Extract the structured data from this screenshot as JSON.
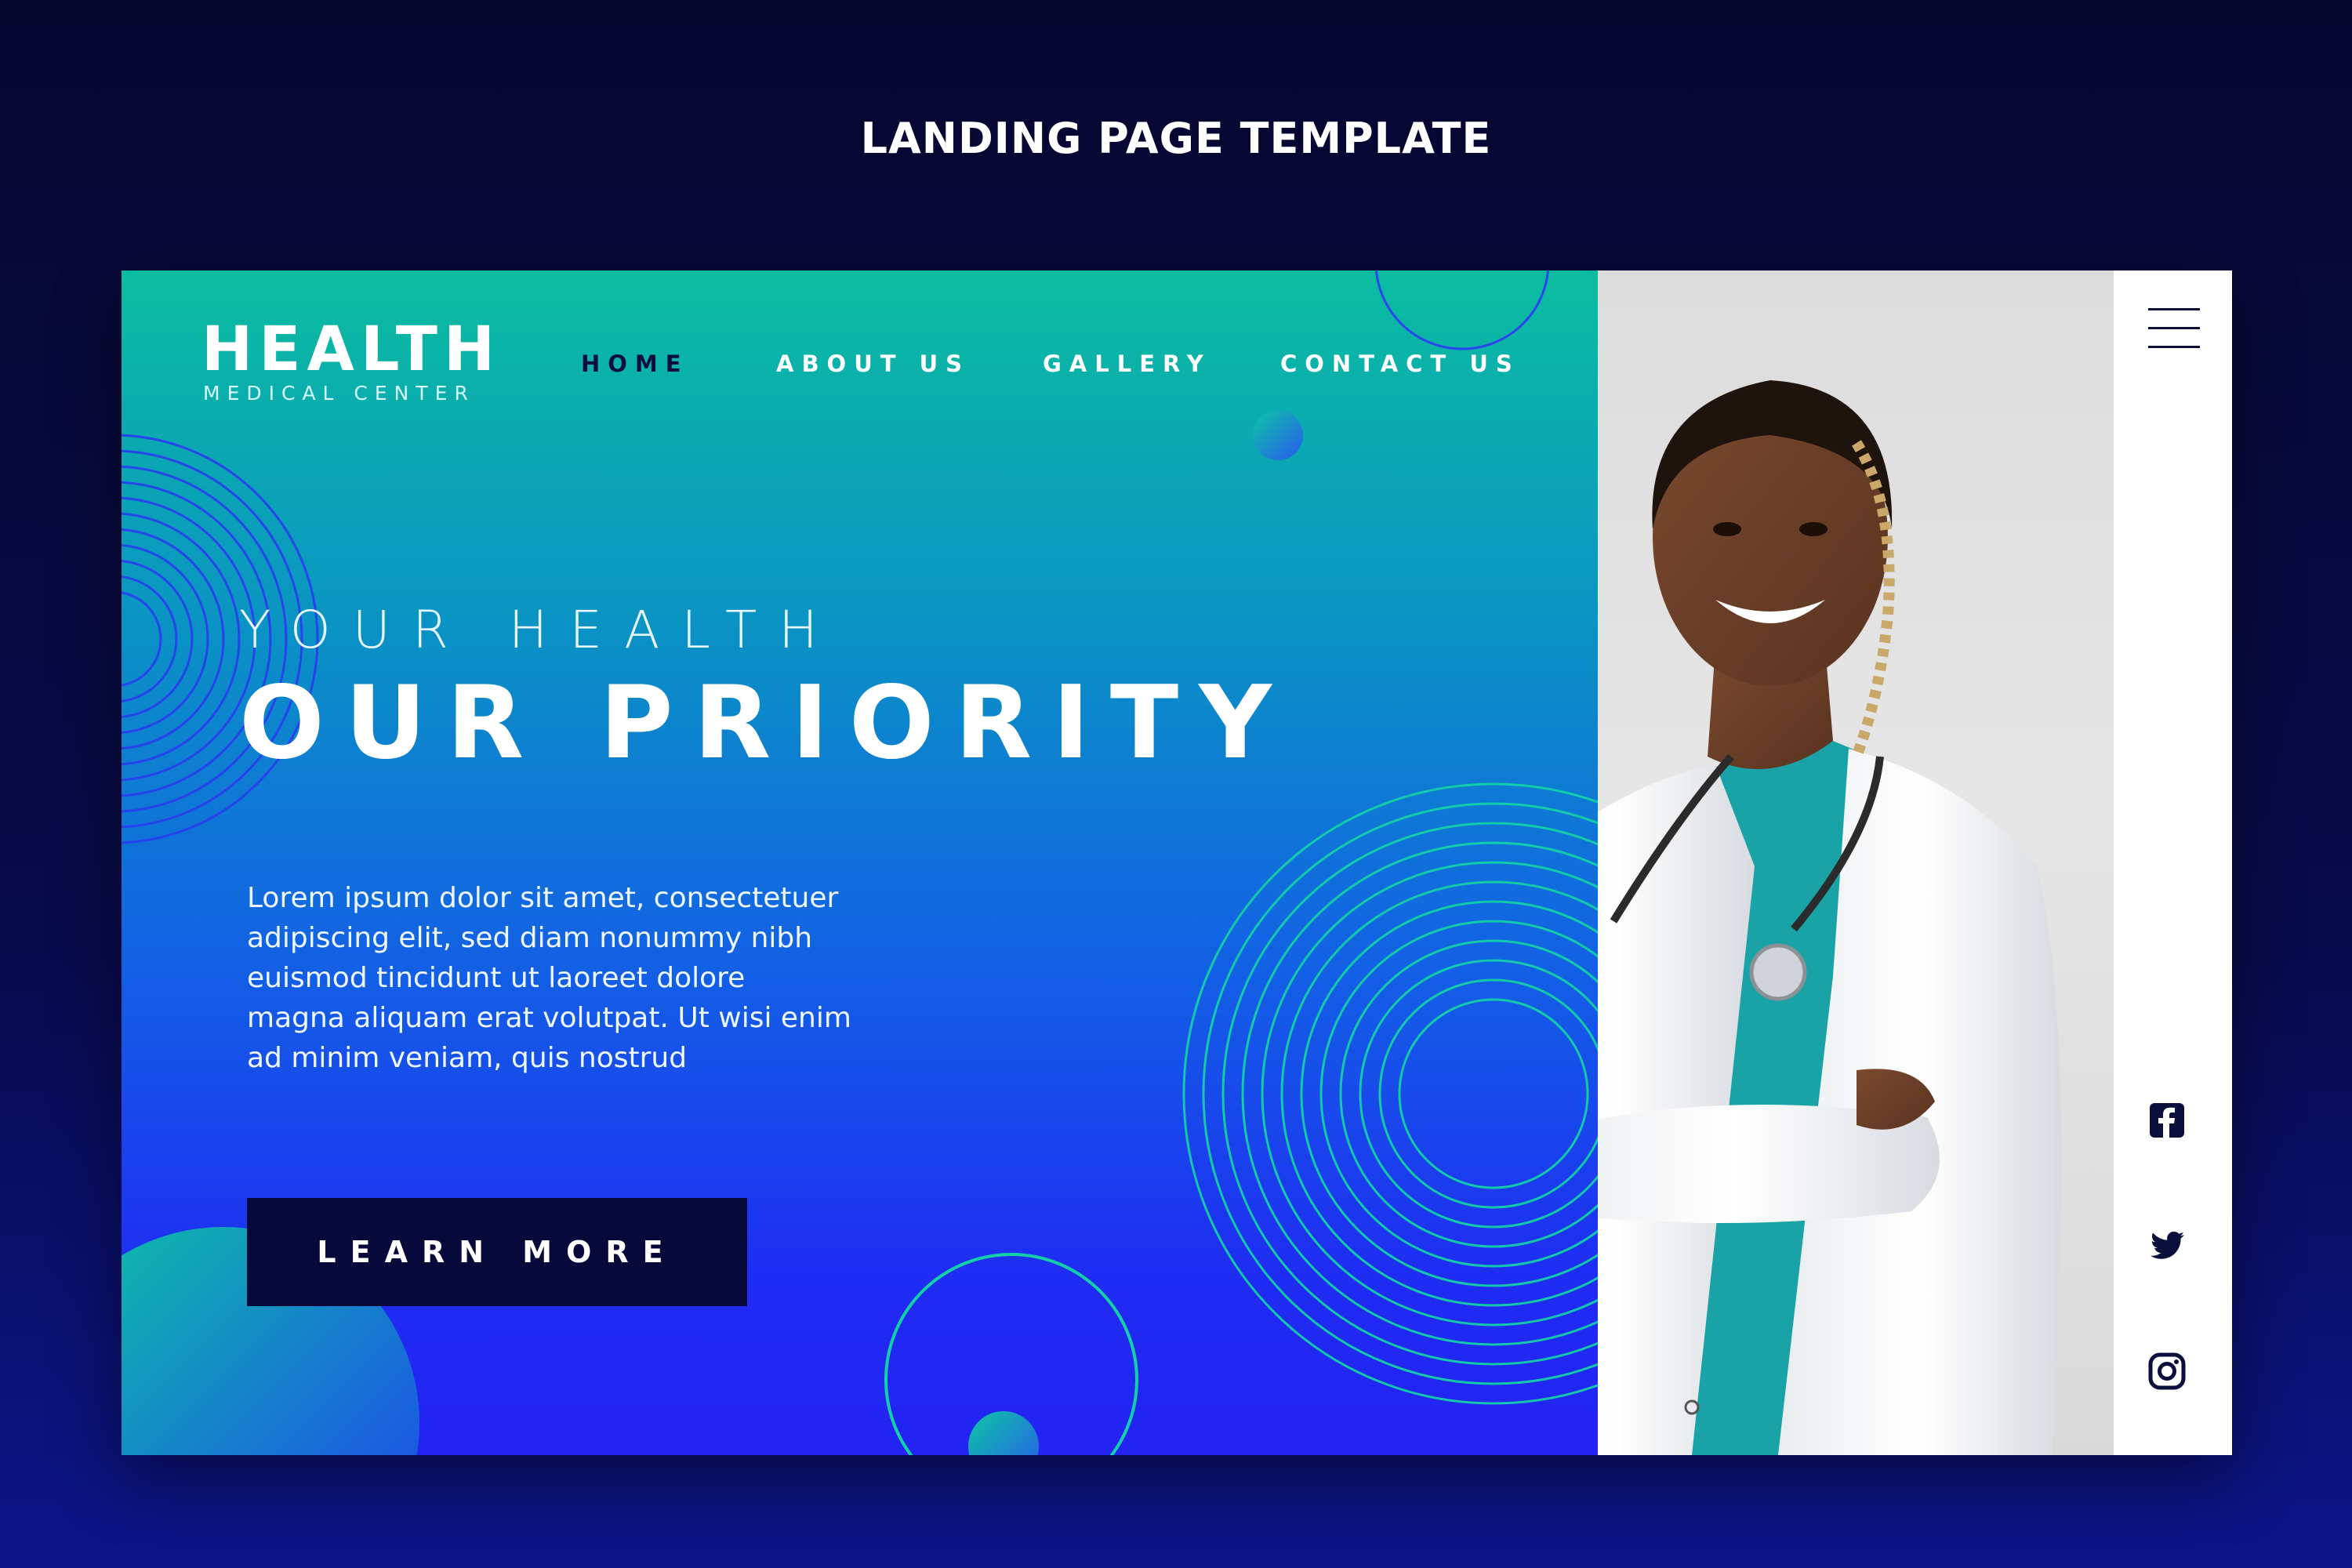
{
  "header": {
    "title": "LANDING PAGE TEMPLATE"
  },
  "brand": {
    "name": "HEALTH",
    "subtitle": "MEDICAL CENTER"
  },
  "nav": {
    "items": [
      {
        "label": "HOME",
        "active": true
      },
      {
        "label": "ABOUT US",
        "active": false
      },
      {
        "label": "GALLERY",
        "active": false
      },
      {
        "label": "CONTACT US",
        "active": false
      }
    ]
  },
  "hero": {
    "kicker": "YOUR HEALTH",
    "headline": "OUR PRIORITY",
    "body_lines": [
      "Lorem ipsum dolor sit amet, consectetuer",
      "adipiscing elit, sed diam nonummy nibh",
      "euismod tincidunt ut laoreet dolore",
      "magna aliquam erat volutpat. Ut wisi enim",
      "ad minim veniam, quis nostrud"
    ],
    "cta_label": "LEARN MORE"
  },
  "sidebar": {
    "menu_icon": "hamburger-menu-icon",
    "social": [
      {
        "name": "facebook-icon"
      },
      {
        "name": "twitter-icon"
      },
      {
        "name": "instagram-icon"
      }
    ]
  },
  "colors": {
    "background": "#05062e",
    "gradient_top": "#0bbd9f",
    "gradient_bottom": "#2323f2",
    "nav_active": "#0a0f3c",
    "cta_bg": "#06093a"
  }
}
